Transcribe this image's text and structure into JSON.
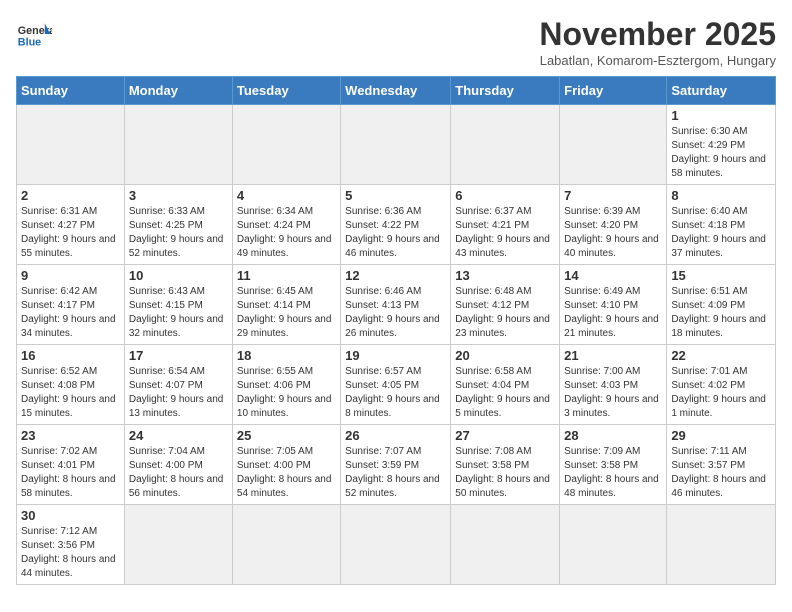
{
  "logo": {
    "general": "General",
    "blue": "Blue"
  },
  "title": "November 2025",
  "subtitle": "Labatlan, Komarom-Esztergom, Hungary",
  "weekdays": [
    "Sunday",
    "Monday",
    "Tuesday",
    "Wednesday",
    "Thursday",
    "Friday",
    "Saturday"
  ],
  "weeks": [
    [
      {
        "day": null,
        "info": null
      },
      {
        "day": null,
        "info": null
      },
      {
        "day": null,
        "info": null
      },
      {
        "day": null,
        "info": null
      },
      {
        "day": null,
        "info": null
      },
      {
        "day": null,
        "info": null
      },
      {
        "day": "1",
        "info": "Sunrise: 6:30 AM\nSunset: 4:29 PM\nDaylight: 9 hours\nand 58 minutes."
      }
    ],
    [
      {
        "day": "2",
        "info": "Sunrise: 6:31 AM\nSunset: 4:27 PM\nDaylight: 9 hours\nand 55 minutes."
      },
      {
        "day": "3",
        "info": "Sunrise: 6:33 AM\nSunset: 4:25 PM\nDaylight: 9 hours\nand 52 minutes."
      },
      {
        "day": "4",
        "info": "Sunrise: 6:34 AM\nSunset: 4:24 PM\nDaylight: 9 hours\nand 49 minutes."
      },
      {
        "day": "5",
        "info": "Sunrise: 6:36 AM\nSunset: 4:22 PM\nDaylight: 9 hours\nand 46 minutes."
      },
      {
        "day": "6",
        "info": "Sunrise: 6:37 AM\nSunset: 4:21 PM\nDaylight: 9 hours\nand 43 minutes."
      },
      {
        "day": "7",
        "info": "Sunrise: 6:39 AM\nSunset: 4:20 PM\nDaylight: 9 hours\nand 40 minutes."
      },
      {
        "day": "8",
        "info": "Sunrise: 6:40 AM\nSunset: 4:18 PM\nDaylight: 9 hours\nand 37 minutes."
      }
    ],
    [
      {
        "day": "9",
        "info": "Sunrise: 6:42 AM\nSunset: 4:17 PM\nDaylight: 9 hours\nand 34 minutes."
      },
      {
        "day": "10",
        "info": "Sunrise: 6:43 AM\nSunset: 4:15 PM\nDaylight: 9 hours\nand 32 minutes."
      },
      {
        "day": "11",
        "info": "Sunrise: 6:45 AM\nSunset: 4:14 PM\nDaylight: 9 hours\nand 29 minutes."
      },
      {
        "day": "12",
        "info": "Sunrise: 6:46 AM\nSunset: 4:13 PM\nDaylight: 9 hours\nand 26 minutes."
      },
      {
        "day": "13",
        "info": "Sunrise: 6:48 AM\nSunset: 4:12 PM\nDaylight: 9 hours\nand 23 minutes."
      },
      {
        "day": "14",
        "info": "Sunrise: 6:49 AM\nSunset: 4:10 PM\nDaylight: 9 hours\nand 21 minutes."
      },
      {
        "day": "15",
        "info": "Sunrise: 6:51 AM\nSunset: 4:09 PM\nDaylight: 9 hours\nand 18 minutes."
      }
    ],
    [
      {
        "day": "16",
        "info": "Sunrise: 6:52 AM\nSunset: 4:08 PM\nDaylight: 9 hours\nand 15 minutes."
      },
      {
        "day": "17",
        "info": "Sunrise: 6:54 AM\nSunset: 4:07 PM\nDaylight: 9 hours\nand 13 minutes."
      },
      {
        "day": "18",
        "info": "Sunrise: 6:55 AM\nSunset: 4:06 PM\nDaylight: 9 hours\nand 10 minutes."
      },
      {
        "day": "19",
        "info": "Sunrise: 6:57 AM\nSunset: 4:05 PM\nDaylight: 9 hours\nand 8 minutes."
      },
      {
        "day": "20",
        "info": "Sunrise: 6:58 AM\nSunset: 4:04 PM\nDaylight: 9 hours\nand 5 minutes."
      },
      {
        "day": "21",
        "info": "Sunrise: 7:00 AM\nSunset: 4:03 PM\nDaylight: 9 hours\nand 3 minutes."
      },
      {
        "day": "22",
        "info": "Sunrise: 7:01 AM\nSunset: 4:02 PM\nDaylight: 9 hours\nand 1 minute."
      }
    ],
    [
      {
        "day": "23",
        "info": "Sunrise: 7:02 AM\nSunset: 4:01 PM\nDaylight: 8 hours\nand 58 minutes."
      },
      {
        "day": "24",
        "info": "Sunrise: 7:04 AM\nSunset: 4:00 PM\nDaylight: 8 hours\nand 56 minutes."
      },
      {
        "day": "25",
        "info": "Sunrise: 7:05 AM\nSunset: 4:00 PM\nDaylight: 8 hours\nand 54 minutes."
      },
      {
        "day": "26",
        "info": "Sunrise: 7:07 AM\nSunset: 3:59 PM\nDaylight: 8 hours\nand 52 minutes."
      },
      {
        "day": "27",
        "info": "Sunrise: 7:08 AM\nSunset: 3:58 PM\nDaylight: 8 hours\nand 50 minutes."
      },
      {
        "day": "28",
        "info": "Sunrise: 7:09 AM\nSunset: 3:58 PM\nDaylight: 8 hours\nand 48 minutes."
      },
      {
        "day": "29",
        "info": "Sunrise: 7:11 AM\nSunset: 3:57 PM\nDaylight: 8 hours\nand 46 minutes."
      }
    ],
    [
      {
        "day": "30",
        "info": "Sunrise: 7:12 AM\nSunset: 3:56 PM\nDaylight: 8 hours\nand 44 minutes."
      },
      {
        "day": null,
        "info": null
      },
      {
        "day": null,
        "info": null
      },
      {
        "day": null,
        "info": null
      },
      {
        "day": null,
        "info": null
      },
      {
        "day": null,
        "info": null
      },
      {
        "day": null,
        "info": null
      }
    ]
  ]
}
